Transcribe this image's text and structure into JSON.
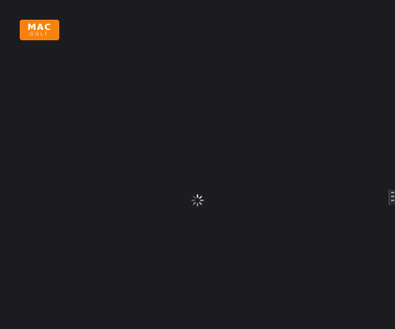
{
  "logo": {
    "main_text": "MAC",
    "sub_text": "GOLF",
    "color": "#f5820d"
  },
  "background_color": "#1c1c20",
  "loading": {
    "icon": "loading-spinner-icon"
  },
  "edge_tab": {
    "icon": "side-panel-handle-icon"
  }
}
